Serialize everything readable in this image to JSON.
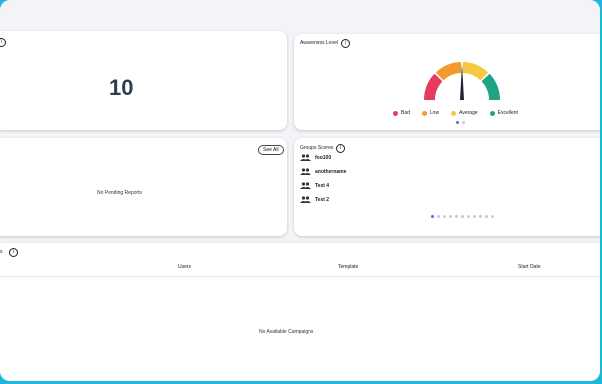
{
  "stat_card": {
    "value": "10"
  },
  "awareness": {
    "title": "Awareness Level",
    "legend": [
      {
        "label": "Bad",
        "color": "#e63a5e"
      },
      {
        "label": "Low",
        "color": "#f29a2e"
      },
      {
        "label": "Average",
        "color": "#f5c842"
      },
      {
        "label": "Excellent",
        "color": "#1fa386"
      }
    ]
  },
  "pending_reports": {
    "see_all_label": "See All",
    "empty_message": "No Pending Reports"
  },
  "groups_scores": {
    "title": "Groups Scores",
    "groups": [
      "foo100",
      "anothername",
      "Test 4",
      "Test 2"
    ]
  },
  "campaigns": {
    "title_fragment": "s",
    "columns": [
      "Users",
      "Template",
      "Start Date"
    ],
    "empty_message": "No Available Campaigns"
  },
  "icons": {
    "info": "info-icon",
    "group": "group-icon"
  }
}
